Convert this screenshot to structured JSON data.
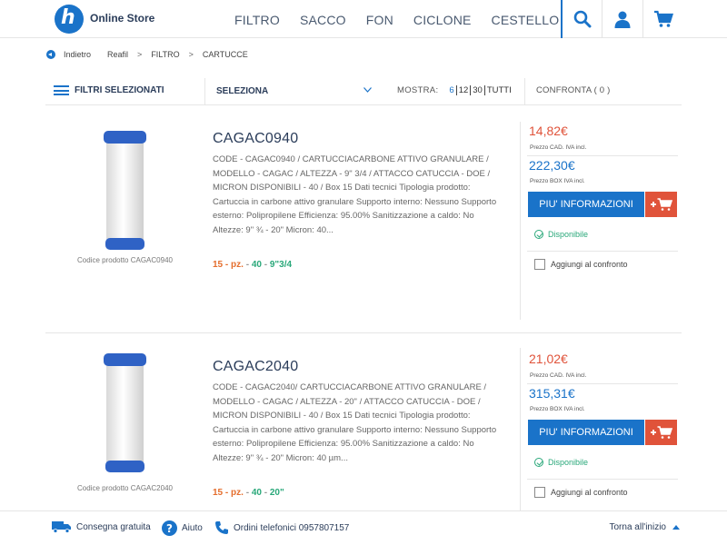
{
  "header": {
    "logo_letter": "h",
    "store_name": "Online Store",
    "nav": [
      "FILTRO",
      "SACCO",
      "FON",
      "CICLONE",
      "CESTELLO"
    ],
    "icons": [
      "search-icon",
      "user-icon",
      "cart-icon"
    ],
    "brand_color": "#1a73c9"
  },
  "breadcrumb": {
    "back": "Indietro",
    "items": [
      "Reafil",
      "FILTRO",
      "CARTUCCE"
    ],
    "separator": ">"
  },
  "filters": {
    "selected_label": "FILTRI SELEZIONATI",
    "select_value": "SELEZIONA",
    "show_label": "MOSTRA:",
    "show_options": [
      "6",
      "12",
      "30",
      "TUTTI"
    ],
    "compare_label": "CONFRONTA ( 0 )"
  },
  "products": [
    {
      "code_label": "Codice prodotto CAGAC0940",
      "title": "CAGAC0940",
      "description": "CODE - CAGAC0940 / CARTUCCIACARBONE ATTIVO GRANULARE / MODELLO - CAGAC / ALTEZZA - 9\" 3/4 / ATTACCO CATUCCIA - DOE / MICRON DISPONIBILI - 40 / Box 15 Dati tecnici Tipologia prodotto: Cartuccia in carbone attivo granulare Supporto interno: Nessuno Supporto esterno: Polipropilene Efficienza: 95.00% Sanitizzazione a caldo: No Altezze: 9\" ¾ - 20\" Micron: 40...",
      "meta_qty": "15 - pz.",
      "meta_micron": "40",
      "meta_height": "9\"3/4",
      "meta_sep": "-",
      "price_unit": "14,82€",
      "price_unit_note": "Prezzo CAD. IVA incl.",
      "price_box": "222,30€",
      "price_box_note": "Prezzo BOX IVA incl.",
      "info_button": "PIU' INFORMAZIONI",
      "availability": "Disponibile",
      "compare": "Aggiungi al confronto"
    },
    {
      "code_label": "Codice prodotto CAGAC2040",
      "title": "CAGAC2040",
      "description": "CODE - CAGAC2040/ CARTUCCIACARBONE ATTIVO GRANULARE / MODELLO - CAGAC / ALTEZZA - 20\" / ATTACCO CATUCCIA - DOE / MICRON DISPONIBILI - 40 / Box 15 Dati tecnici Tipologia prodotto: Cartuccia in carbone attivo granulare Supporto interno: Nessuno Supporto esterno: Polipropilene Efficienza: 95.00% Sanitizzazione a caldo: No Altezze: 9\" ¾ - 20\" Micron: 40 µm...",
      "meta_qty": "15 - pz.",
      "meta_micron": "40",
      "meta_height": "20\"",
      "meta_sep": "-",
      "price_unit": "21,02€",
      "price_unit_note": "Prezzo CAD. IVA incl.",
      "price_box": "315,31€",
      "price_box_note": "Prezzo BOX IVA incl.",
      "info_button": "PIU' INFORMAZIONI",
      "availability": "Disponibile",
      "compare": "Aggiungi al confronto"
    }
  ],
  "footer": {
    "shipping": "Consegna gratuita",
    "help": "Aiuto",
    "phone": "Ordini telefonici 0957807157",
    "to_top": "Torna all'inizio"
  }
}
